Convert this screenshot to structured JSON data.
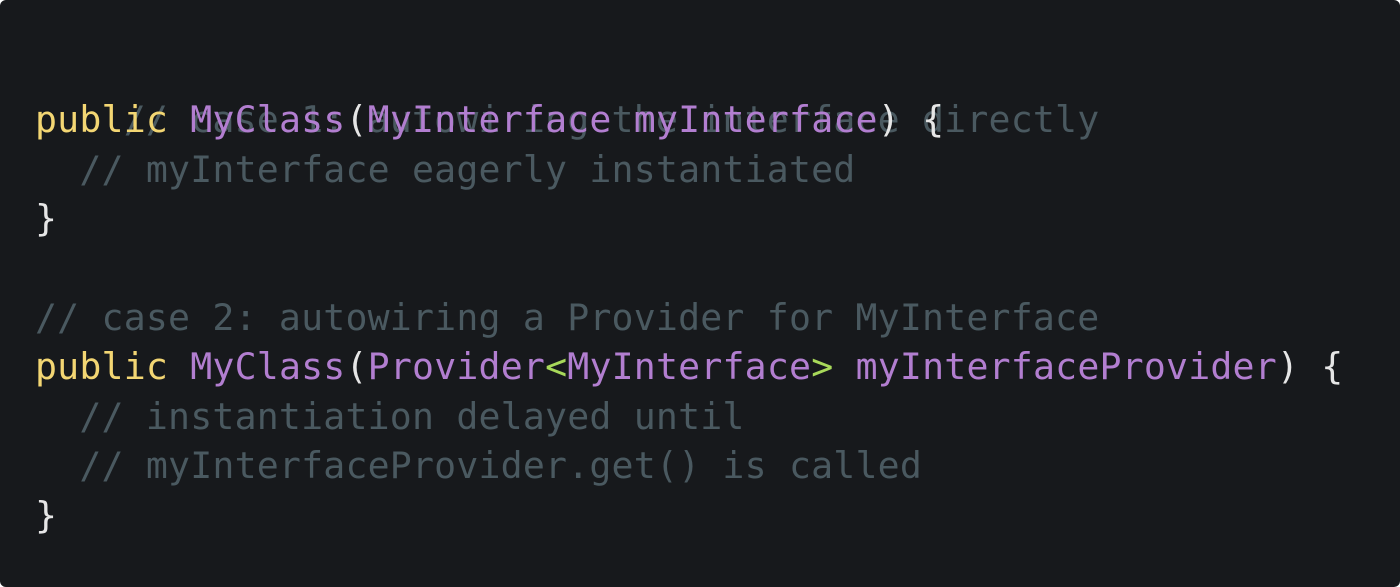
{
  "colors": {
    "background": "#17191c",
    "comment": "#4a5960",
    "keyword": "#f3d673",
    "identifier": "#b27ed0",
    "punctuation": "#e6e6e6",
    "generic_bracket": "#a8d95a"
  },
  "code": {
    "lines": [
      {
        "tokens": [
          {
            "t": "// case 1: autowiring the interface directly",
            "k": "comment"
          }
        ]
      },
      {
        "tokens": [
          {
            "t": "public",
            "k": "keyword"
          },
          {
            "t": " ",
            "k": "punct"
          },
          {
            "t": "MyClass",
            "k": "type"
          },
          {
            "t": "(",
            "k": "punct"
          },
          {
            "t": "MyInterface",
            "k": "type"
          },
          {
            "t": " ",
            "k": "punct"
          },
          {
            "t": "myInterface",
            "k": "type"
          },
          {
            "t": ") {",
            "k": "punct"
          }
        ]
      },
      {
        "tokens": [
          {
            "t": "  // myInterface eagerly instantiated",
            "k": "comment"
          }
        ]
      },
      {
        "tokens": [
          {
            "t": "}",
            "k": "punct"
          }
        ]
      },
      {
        "tokens": [
          {
            "t": "",
            "k": "punct"
          }
        ]
      },
      {
        "tokens": [
          {
            "t": "// case 2: autowiring a Provider for MyInterface",
            "k": "comment"
          }
        ]
      },
      {
        "tokens": [
          {
            "t": "public",
            "k": "keyword"
          },
          {
            "t": " ",
            "k": "punct"
          },
          {
            "t": "MyClass",
            "k": "type"
          },
          {
            "t": "(",
            "k": "punct"
          },
          {
            "t": "Provider",
            "k": "type"
          },
          {
            "t": "<",
            "k": "generic"
          },
          {
            "t": "MyInterface",
            "k": "type"
          },
          {
            "t": ">",
            "k": "generic"
          },
          {
            "t": " ",
            "k": "punct"
          },
          {
            "t": "myInterfaceProvider",
            "k": "type"
          },
          {
            "t": ") {",
            "k": "punct"
          }
        ]
      },
      {
        "tokens": [
          {
            "t": "  // instantiation delayed until",
            "k": "comment"
          }
        ]
      },
      {
        "tokens": [
          {
            "t": "  // myInterfaceProvider.get() is called",
            "k": "comment"
          }
        ]
      },
      {
        "tokens": [
          {
            "t": "}",
            "k": "punct"
          }
        ]
      }
    ]
  }
}
